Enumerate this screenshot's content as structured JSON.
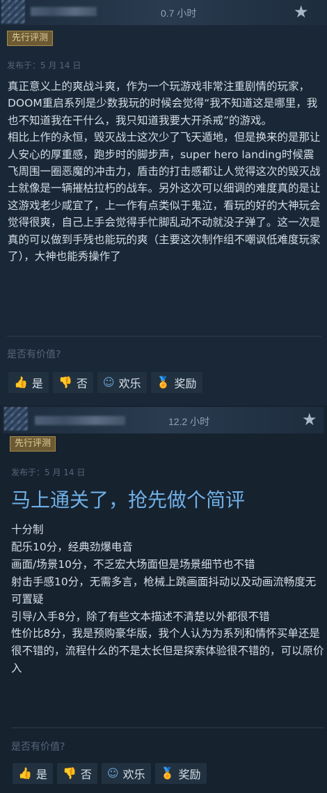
{
  "reviews": [
    {
      "hours": "0.7 小时",
      "badge": "先行评测",
      "posted": "发布于：5 月 14 日",
      "title": "",
      "body": "真正意义上的爽战斗爽，作为一个玩游戏非常注重剧情的玩家，DOOM重启系列是少数我玩的时候会觉得“我不知道这是哪里，我也不知道我在干什么，我只知道我要大开杀戒”的游戏。\n相比上作的永恒，毁灭战士这次少了飞天遁地，但是换来的是那让人安心的厚重感，跑步时的脚步声，super hero landing时候震飞周围一圈恶魔的冲击力，盾击的打击感都让人觉得这次的毁灭战士就像是一辆摧枯拉朽的战车。另外这次可以细调的难度真的是让这游戏老少咸宜了，上一作有点类似于鬼泣，看玩的好的大神玩会觉得很爽，自己上手会觉得手忙脚乱动不动就没子弹了。这一次是真的可以做到手残也能玩的爽（主要这次制作组不嘲讽低难度玩家了），大神也能秀操作了",
      "helpful_prompt": "是否有价值?",
      "buttons": {
        "yes": "是",
        "no": "否",
        "funny": "欢乐",
        "award": "奖励"
      }
    },
    {
      "hours": "12.2 小时",
      "badge": "先行评测",
      "posted": "发布于：5 月 14 日",
      "title": "马上通关了，抢先做个简评",
      "body": "十分制\n配乐10分，经典劲爆电音\n画面/场景10分，不乏宏大场面但是场景细节也不错\n射击手感10分，无需多言，枪械上跳画面抖动以及动画流畅度无可置疑\n引导/入手8分，除了有些文本描述不清楚以外都很不错\n性价比8分，我是预购豪华版，我个人认为为系列和情怀买单还是很不错的，流程什么的不是太长但是探索体验很不错的，可以原价入",
      "helpful_prompt": "是否有价值?",
      "buttons": {
        "yes": "是",
        "no": "否",
        "funny": "欢乐",
        "award": "奖励"
      }
    }
  ],
  "icons": {
    "favorite": "star-icon",
    "yes": "thumbs-up-icon",
    "no": "thumbs-down-icon",
    "funny": "smiley-icon",
    "award": "award-icon"
  },
  "colors": {
    "background": "#1b2838",
    "badge_bg": "#6c5a33",
    "badge_text": "#e3cf9b",
    "title": "#6fb0e6",
    "vote_icon": "#6aa5d9",
    "award_icon": "#e3b53b"
  }
}
